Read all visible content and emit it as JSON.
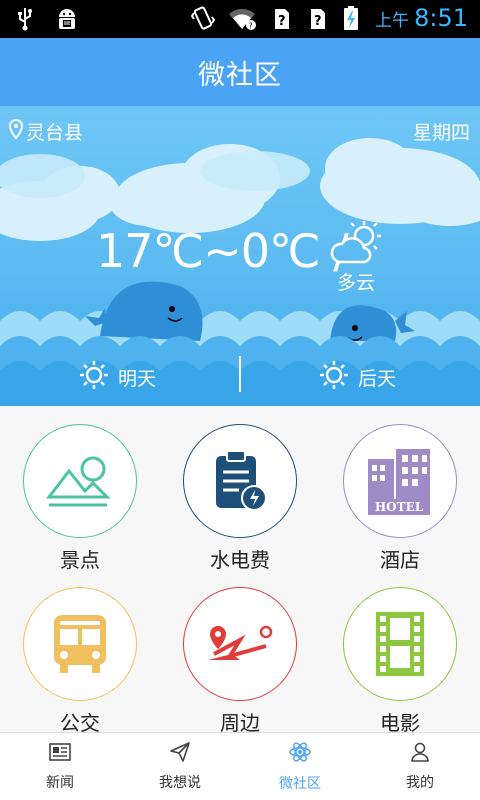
{
  "status_bar": {
    "ampm": "上午",
    "time": "8:51",
    "accent": "#3fb5ff"
  },
  "header": {
    "title": "微社区",
    "color": "#4aa3f5"
  },
  "weather": {
    "location": "灵台县",
    "weekday": "星期四",
    "temperature": "17℃~0℃ /",
    "condition": "多云",
    "forecast": [
      {
        "label": "明天",
        "icon": "sun-icon"
      },
      {
        "label": "后天",
        "icon": "sun-icon"
      }
    ]
  },
  "grid": [
    {
      "label": "景点",
      "icon": "mountain-icon",
      "color": "#4cc3a0"
    },
    {
      "label": "水电费",
      "icon": "utility-bill-icon",
      "color": "#1d4f78"
    },
    {
      "label": "酒店",
      "icon": "hotel-icon",
      "color": "#9f8bc6"
    },
    {
      "label": "公交",
      "icon": "bus-icon",
      "color": "#f0c060"
    },
    {
      "label": "周边",
      "icon": "map-route-icon",
      "color": "#e23b3b"
    },
    {
      "label": "电影",
      "icon": "film-icon",
      "color": "#8dc63f"
    }
  ],
  "hotel_sign": "HOTEL",
  "tabs": [
    {
      "label": "新闻",
      "icon": "news-icon",
      "active": false
    },
    {
      "label": "我想说",
      "icon": "paper-plane-icon",
      "active": false
    },
    {
      "label": "微社区",
      "icon": "atom-icon",
      "active": true
    },
    {
      "label": "我的",
      "icon": "user-icon",
      "active": false
    }
  ]
}
